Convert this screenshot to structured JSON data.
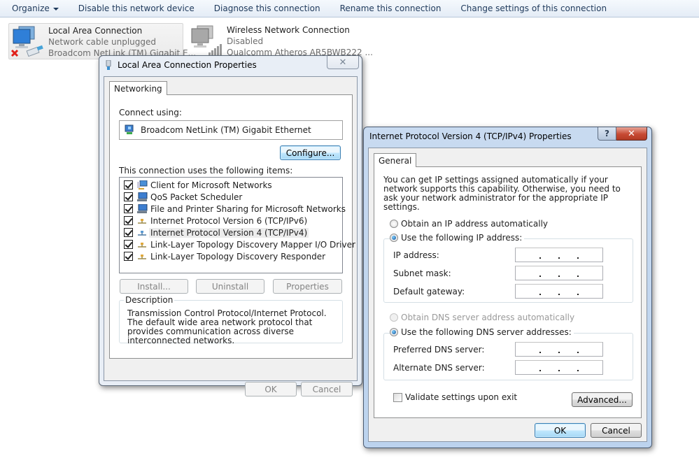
{
  "toolbar": {
    "items": [
      {
        "label": "Organize",
        "has_dropdown": true
      },
      {
        "label": "Disable this network device"
      },
      {
        "label": "Diagnose this connection"
      },
      {
        "label": "Rename this connection"
      },
      {
        "label": "Change settings of this connection"
      }
    ]
  },
  "connections": [
    {
      "name": "Local Area Connection",
      "status": "Network cable unplugged",
      "device": "Broadcom NetLink (TM) Gigabit E...",
      "selected": true,
      "error_icon": true
    },
    {
      "name": "Wireless Network Connection",
      "status": "Disabled",
      "device": "Qualcomm Atheros AR5BWB222 ...",
      "selected": false
    }
  ],
  "lac_dialog": {
    "title": "Local Area Connection Properties",
    "close_label": "✕",
    "tab": "Networking",
    "connect_using_label": "Connect using:",
    "adapter": "Broadcom NetLink (TM) Gigabit Ethernet",
    "configure_label": "Configure...",
    "items_label": "This connection uses the following items:",
    "items": [
      {
        "label": "Client for Microsoft Networks",
        "checked": true,
        "icon": "network-client-icon"
      },
      {
        "label": "QoS Packet Scheduler",
        "checked": true,
        "icon": "computer-service-icon"
      },
      {
        "label": "File and Printer Sharing for Microsoft Networks",
        "checked": true,
        "icon": "computer-service-icon"
      },
      {
        "label": "Internet Protocol Version 6 (TCP/IPv6)",
        "checked": true,
        "icon": "protocol-icon"
      },
      {
        "label": "Internet Protocol Version 4 (TCP/IPv4)",
        "checked": true,
        "icon": "protocol-icon",
        "selected": true
      },
      {
        "label": "Link-Layer Topology Discovery Mapper I/O Driver",
        "checked": true,
        "icon": "protocol-icon"
      },
      {
        "label": "Link-Layer Topology Discovery Responder",
        "checked": true,
        "icon": "protocol-icon"
      }
    ],
    "install_label": "Install...",
    "uninstall_label": "Uninstall",
    "properties_label": "Properties",
    "description_legend": "Description",
    "description_text": "Transmission Control Protocol/Internet Protocol. The default wide area network protocol that provides communication across diverse interconnected networks.",
    "ok_label": "OK",
    "cancel_label": "Cancel"
  },
  "ipv4_dialog": {
    "title": "Internet Protocol Version 4 (TCP/IPv4) Properties",
    "help_label": "?",
    "close_label": "✕",
    "tab": "General",
    "intro": "You can get IP settings assigned automatically if your network supports this capability. Otherwise, you need to ask your network administrator for the appropriate IP settings.",
    "ip_auto_label": "Obtain an IP address automatically",
    "ip_manual_label": "Use the following IP address:",
    "ip_mode": "manual",
    "ip_fields": [
      {
        "label": "IP address:",
        "value": ""
      },
      {
        "label": "Subnet mask:",
        "value": ""
      },
      {
        "label": "Default gateway:",
        "value": ""
      }
    ],
    "dns_auto_label": "Obtain DNS server address automatically",
    "dns_manual_label": "Use the following DNS server addresses:",
    "dns_mode": "manual",
    "dns_fields": [
      {
        "label": "Preferred DNS server:",
        "value": ""
      },
      {
        "label": "Alternate DNS server:",
        "value": ""
      }
    ],
    "validate_label": "Validate settings upon exit",
    "validate_checked": false,
    "advanced_label": "Advanced...",
    "ok_label": "OK",
    "cancel_label": "Cancel"
  }
}
